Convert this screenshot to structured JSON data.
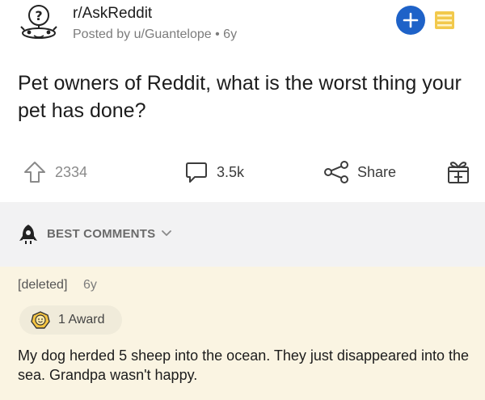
{
  "post": {
    "subreddit": "r/AskReddit",
    "posted_by": "Posted by u/Guantelope • 6y",
    "title": "Pet owners of Reddit, what is the worst thing your pet has done?"
  },
  "icons": {
    "subreddit_avatar": "askreddit-snoo-icon",
    "join": "plus-icon",
    "menu": "menu-icon",
    "upvote": "upvote-arrow-icon",
    "comments": "comment-bubble-icon",
    "share": "share-icon",
    "award": "gift-icon",
    "sort": "rocket-icon",
    "chevron": "chevron-down-icon",
    "comment_award": "wholesome-award-icon"
  },
  "actions": {
    "votes": "2334",
    "comments": "3.5k",
    "share": "Share"
  },
  "sort": {
    "label": "BEST COMMENTS"
  },
  "comment": {
    "author": "[deleted]",
    "age": "6y",
    "award_label": "1 Award",
    "body": "My dog herded 5 sheep into the ocean. They just disappeared into the sea. Grandpa wasn't happy."
  },
  "colors": {
    "join_button": "#1e62c8",
    "menu_accent": "#f2c94c",
    "comment_highlight": "#faf4e2",
    "sortbar_bg": "#f2f2f3"
  }
}
